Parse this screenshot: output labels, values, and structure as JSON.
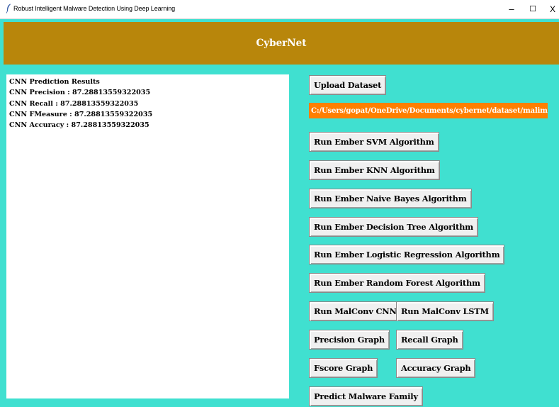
{
  "window": {
    "title": "Robust Intelligent Malware Detection Using Deep Learning",
    "minimize_glyph": "–",
    "maximize_glyph": "☐",
    "close_glyph": "X"
  },
  "header": {
    "title": "CyberNet"
  },
  "results": {
    "lines": [
      "CNN Prediction Results",
      "CNN Precision : 87.28813559322035",
      "CNN Recall : 87.28813559322035",
      "CNN FMeasure : 87.28813559322035",
      "CNN Accuracy : 87.28813559322035"
    ]
  },
  "controls": {
    "upload_dataset": "Upload  Dataset",
    "dataset_path": "C:/Users/gopat/OneDrive/Documents/cybernet/dataset/malimg.npz",
    "run_svm": "Run Ember SVM Algorithm",
    "run_knn": "Run Ember KNN Algorithm",
    "run_naive_bayes": "Run Ember Naive Bayes Algorithm",
    "run_decision_tree": "Run Ember Decision Tree Algorithm",
    "run_logistic_regression": "Run Ember Logistic Regression Algorithm",
    "run_random_forest": "Run Ember Random Forest Algorithm",
    "run_malconv_cnn": "Run MalConv CNN",
    "run_malconv_lstm": "Run MalConv LSTM",
    "precision_graph": "Precision Graph",
    "recall_graph": "Recall Graph",
    "fscore_graph": "Fscore Graph",
    "accuracy_graph": "Accuracy Graph",
    "predict_family": "Predict Malware Family"
  },
  "colors": {
    "background": "#40e0d0",
    "header_bg": "#b8860b",
    "path_bg": "#ff7f00"
  }
}
